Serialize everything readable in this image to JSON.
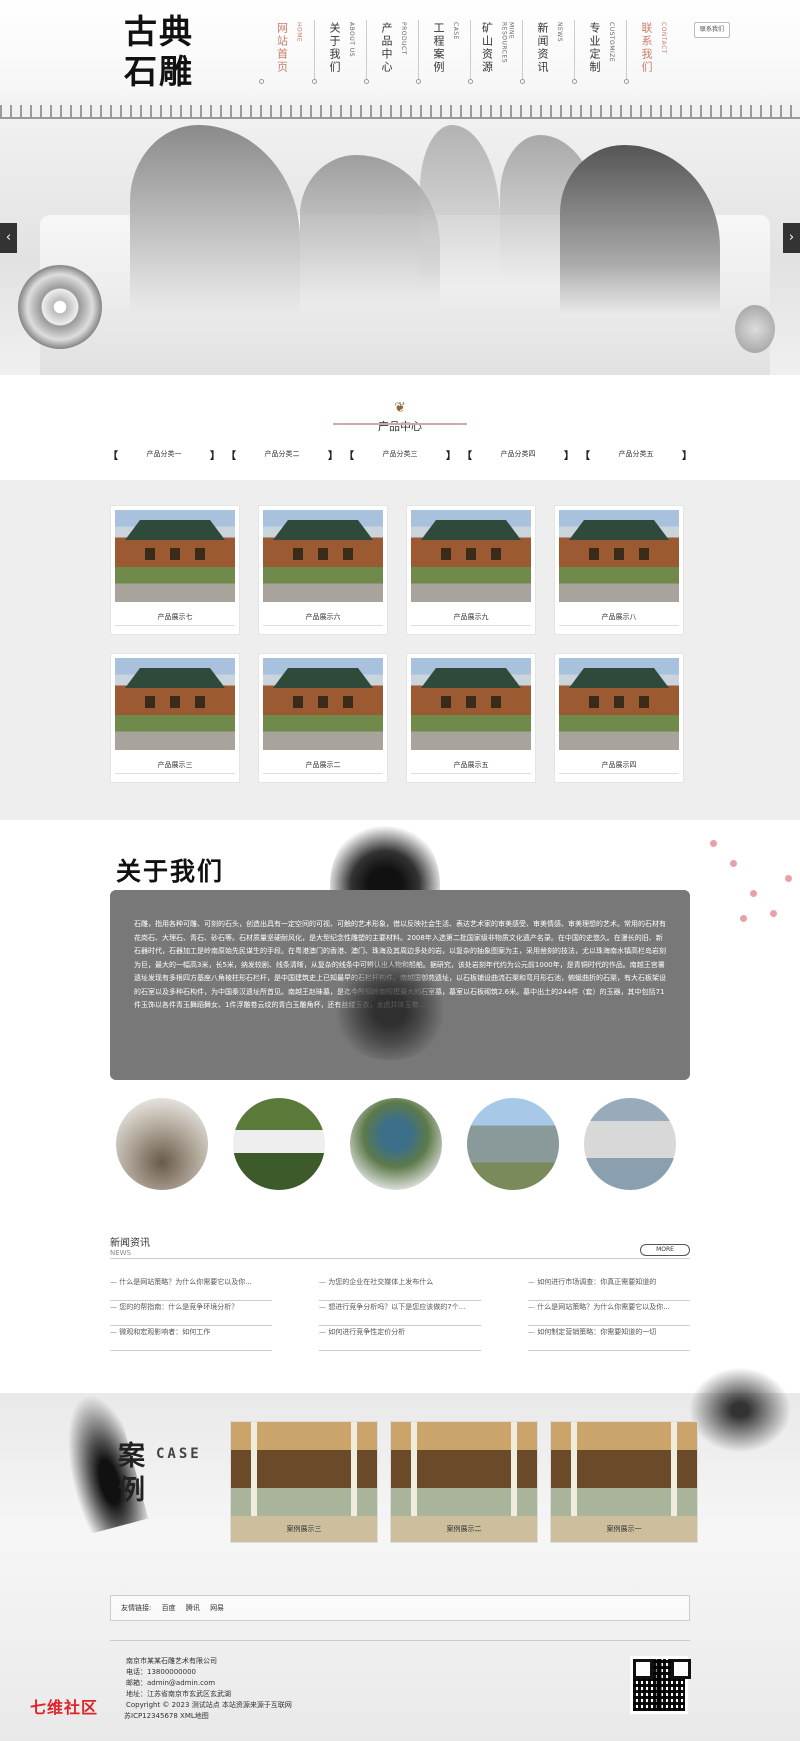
{
  "header": {
    "logo_line1": "古典",
    "logo_line2": "石雕",
    "phone_button": "联系我们",
    "nav": [
      {
        "cn": "网站首页",
        "en": "HOME"
      },
      {
        "cn": "关于我们",
        "en": "ABOUT US"
      },
      {
        "cn": "产品中心",
        "en": "PRODUCT"
      },
      {
        "cn": "工程案例",
        "en": "CASE"
      },
      {
        "cn": "矿山资源",
        "en": "MINE RESOURCES"
      },
      {
        "cn": "新闻资讯",
        "en": "NEWS"
      },
      {
        "cn": "专业定制",
        "en": "CUSTOMIZE"
      },
      {
        "cn": "联系我们",
        "en": "CONTACT"
      }
    ]
  },
  "banner": {
    "prev": "‹",
    "next": "›"
  },
  "products": {
    "title": "产品中心",
    "categories": [
      "产品分类一",
      "产品分类二",
      "产品分类三",
      "产品分类四",
      "产品分类五"
    ],
    "items": [
      "产品展示七",
      "产品展示六",
      "产品展示九",
      "产品展示八",
      "产品展示三",
      "产品展示二",
      "产品展示五",
      "产品展示四"
    ]
  },
  "about": {
    "title": "关于我们",
    "text": "石雕，指用各种可雕、可刻的石头，创造出具有一定空间的可视、可触的艺术形象，借以反映社会生活、表达艺术家的审美感受、审美情感、审美理想的艺术。常用的石材有花岗石、大理石、青石、砂石等。石材质量坚硬耐风化，是大型纪念性雕塑的主要材料。2008年入选第二批国家级非物质文化遗产名录。在中国的史悠久。在漫长的旧、新石器时代，石器加工是岭南原始先民谋生的手段。在粤港澳门的香港、澳门、珠海及其周边多处的岩，以复杂的抽象图案为主，采用凿刻的技法，尤以珠海南水镇高栏岛岩刻为巨，最大的一幅高3米，长5米，纳发较剧、线条清晰，从复杂的线条中可辨认出人物和船舶。据研究，该处岩刻年代约为公元前1000年，是青铜时代的作品。南越王宫署遗址发现有多根四方基座八角棱柱形石栏杆，是中国建筑史上已知最早的石栏杆构件。南越国御苑遗址，以石板铺设曲流石渠和弯月形石池，蜿蜒曲折的石渠，有大石板架设的石室以及多种石构件，为中国秦汉遗址所首见。南越王赵昧墓，是迄今所知岭南规模最大的石室墓，墓室以石板砌筑2.6米。墓中出土的244件（套）的玉器，其中包括71件玉饰以各件青玉舞蹈舞女、1件浮雕卷云纹的青白玉雕角杯，还有丝缕玉衣，龙虎并体玉带..."
  },
  "news": {
    "title_cn": "新闻资讯",
    "title_en": "NEWS",
    "more": "MORE",
    "items": [
      "什么是网站策略？为什么你需要它以及你...",
      "为您的企业在社交媒体上发布什么",
      "如何进行市场调查：你真正需要知道的",
      "您的的帮指南：什么是竞争环境分析？",
      "想进行竞争分析吗？以下是您应该做的7个...",
      "什么是网站策略？为什么你需要它以及你...",
      "微观和宏观影响者：如何工作",
      "如何进行竞争性定价分析",
      "如何制定营销策略：你需要知道的一切"
    ]
  },
  "cases": {
    "title_cn": "案例",
    "title_en": "CASE",
    "items": [
      "案例展示三",
      "案例展示二",
      "案例展示一"
    ]
  },
  "footer": {
    "links_label": "友情链接:",
    "links": [
      "百度",
      "腾讯",
      "网易"
    ],
    "company": "南京市某某石雕艺术有限公司",
    "phone": "电话：13800000000",
    "email": "邮箱：admin@admin.com",
    "address": "地址：江苏省南京市玄武区玄武湖",
    "copyright": "Copyright © 2023 测试站点 本站资源来源于互联网",
    "icp": "苏ICP12345678 XML地图",
    "watermark": "七维社区"
  }
}
